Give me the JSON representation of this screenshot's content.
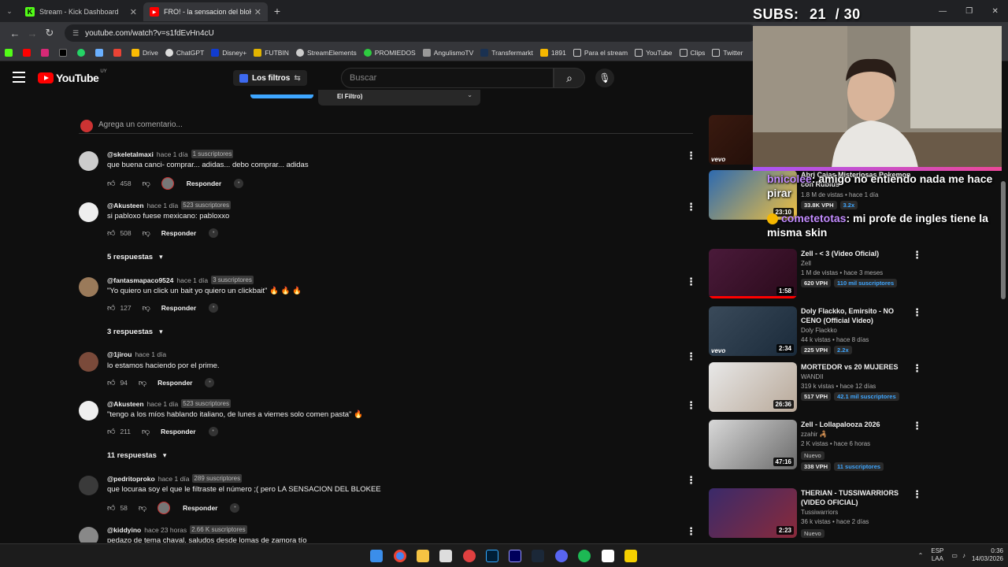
{
  "browser": {
    "tabs": [
      {
        "title": "Stream - Kick Dashboard",
        "icon": "kick-icon",
        "color": "#53fc18"
      },
      {
        "title": "FRO! - la sensacion del bloKe ft",
        "icon": "youtube-icon",
        "color": "#ff0000"
      }
    ],
    "url": "youtube.com/watch?v=s1fdEvHn4cU",
    "bookmarks": [
      "Drive",
      "ChatGPT",
      "Disney+",
      "FUTBIN",
      "StreamElements",
      "PROMIEDOS",
      "AngulismoTV",
      "Transfermarkt",
      "1891",
      "Para el stream",
      "YouTube",
      "Clips",
      "Twitter"
    ]
  },
  "youtube": {
    "logo": "YouTube",
    "country": "UY",
    "filters_label": "Los filtros",
    "search_placeholder": "Buscar",
    "sort_remnant": "El Filtro)",
    "add_comment_placeholder": "Agrega un comentario..."
  },
  "comments": [
    {
      "author": "@skeletalmaxi",
      "time": "hace 1 día",
      "subs": "1 suscriptores",
      "text": "que buena canci- comprar... adidas... debo comprar... adidas",
      "likes": "458",
      "heart": true,
      "reply": "Responder"
    },
    {
      "author": "@Akusteen",
      "time": "hace 1 día",
      "subs": "523 suscriptores",
      "text": "si pabloxo fuese mexicano: pabloxxo",
      "likes": "508",
      "heart": false,
      "reply": "Responder",
      "replies": "5 respuestas"
    },
    {
      "author": "@fantasmapaco9524",
      "time": "hace 1 día",
      "subs": "3 suscriptores",
      "text": "\"Yo quiero un click un bait yo quiero un clickbait\" 🔥 🔥 🔥",
      "likes": "127",
      "heart": false,
      "reply": "Responder",
      "replies": "3 respuestas"
    },
    {
      "author": "@1jirou",
      "time": "hace 1 día",
      "subs": "",
      "text": "lo estamos haciendo por el prime.",
      "likes": "94",
      "heart": false,
      "reply": "Responder"
    },
    {
      "author": "@Akusteen",
      "time": "hace 1 día",
      "subs": "523 suscriptores",
      "text": "\"tengo a los míos hablando italiano, de lunes a viernes solo comen pasta\" 🔥",
      "likes": "211",
      "heart": false,
      "reply": "Responder",
      "replies": "11 respuestas"
    },
    {
      "author": "@pedritoproko",
      "time": "hace 1 día",
      "subs": "289 suscriptores",
      "text": "que locuraa soy el que le filtraste el número ;( pero LA SENSACION DEL BLOKEE",
      "likes": "58",
      "heart": true,
      "reply": "Responder"
    },
    {
      "author": "@kiddyino",
      "time": "hace 23 horas",
      "subs": "2.66 K suscriptores",
      "text": "pedazo de tema chaval, saludos desde lomas de zamora tío",
      "likes": "",
      "heart": false,
      "reply": ""
    }
  ],
  "sidebar": [
    {
      "title": "",
      "channel": "",
      "stats": "",
      "tags": [],
      "duration": "",
      "vevo": true
    },
    {
      "title": "Abri Cajas Misteriosas Pokemon con Rubius",
      "channel": "",
      "stats": "1.8 M de vistas • hace 1 día",
      "tags": [
        "33.8K VPH",
        "3.2x"
      ],
      "duration": "23:10",
      "vevo": false
    },
    {
      "title": "Zell - < 3 (Video Oficial)",
      "channel": "Zell",
      "stats": "1 M de vistas • hace 3 meses",
      "tags": [
        "620 VPH",
        "110 mil suscriptores"
      ],
      "duration": "1:58",
      "vevo": false
    },
    {
      "title": "Doly Flackko, Emirsito - NO CENO (Official Video)",
      "channel": "Doly Flackko",
      "stats": "44 k vistas • hace 8 días",
      "tags": [
        "225 VPH",
        "2.2x"
      ],
      "duration": "2:34",
      "vevo": true
    },
    {
      "title": "MORTEDOR vs 20 MUJERES",
      "channel": "WANDII",
      "stats": "319 k vistas • hace 12 días",
      "tags": [
        "517 VPH",
        "42.1 mil suscriptores"
      ],
      "duration": "26:36",
      "vevo": false
    },
    {
      "title": "Zell - Lollapalooza 2026",
      "channel": "zzahir 🦂",
      "stats": "2 K vistas • hace 6 horas",
      "tags": [
        "Nuevo",
        "338 VPH",
        "11 suscriptores"
      ],
      "duration": "47:16",
      "vevo": false
    },
    {
      "title": "THERIAN - TUSSIWARRIORS (VIDEO OFICIAL)",
      "channel": "Tussiwarriors",
      "stats": "36 k vistas • hace 2 días",
      "tags": [
        "Nuevo"
      ],
      "duration": "2:23",
      "vevo": false
    }
  ],
  "overlay": {
    "subs_label": "SUBS:",
    "subs_current": "21",
    "subs_goal": "/ 30",
    "chat": [
      {
        "name": "bnicolee",
        "text": "amigo no entiendo nada me hace pirar"
      },
      {
        "name": "cometetotas",
        "text": "mi profe de ingles tiene la misma skin"
      }
    ]
  },
  "taskbar": {
    "lang": "ESP",
    "lang2": "LAA",
    "time": "0:36",
    "date": "14/03/2026"
  },
  "colors": {
    "accent": "#3ea6ff",
    "youtube_red": "#ff0000",
    "chat_name": "#c38cff"
  }
}
